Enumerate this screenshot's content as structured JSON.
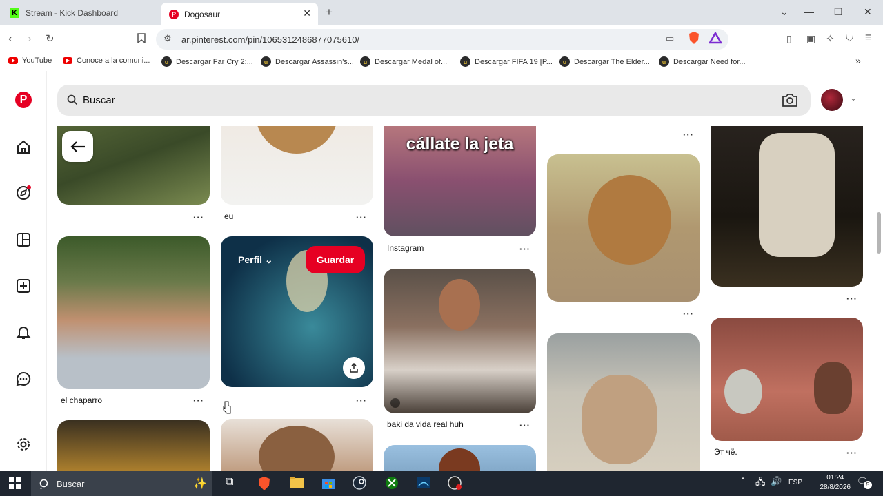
{
  "browser": {
    "tabs": [
      {
        "title": "Stream - Kick Dashboard",
        "favicon": "K"
      },
      {
        "title": "Dogosaur",
        "favicon": "P"
      }
    ],
    "url": "ar.pinterest.com/pin/1065312486877075610/",
    "bookmarks": [
      "YouTube",
      "Conoce a la comuni...",
      "Descargar Far Cry 2:...",
      "Descargar Assassin's...",
      "Descargar Medal of...",
      "Descargar FIFA 19 [P...",
      "Descargar The Elder...",
      "Descargar Need for..."
    ]
  },
  "pinterest": {
    "search_placeholder": "Buscar",
    "overlay": {
      "perfil": "Perfil",
      "save": "Guardar"
    },
    "captions": {
      "eu": "eu",
      "instagram": "Instagram",
      "chaparro": "el chaparro",
      "baki": "baki da vida real huh",
      "ruso": "Эт чё."
    },
    "pin_text": "cállate la jeta",
    "brand_color": "#e60023"
  },
  "taskbar": {
    "search": "Buscar",
    "lang": "ESP",
    "time": "01:24",
    "date": "28/8/2026",
    "notifications": "5"
  }
}
